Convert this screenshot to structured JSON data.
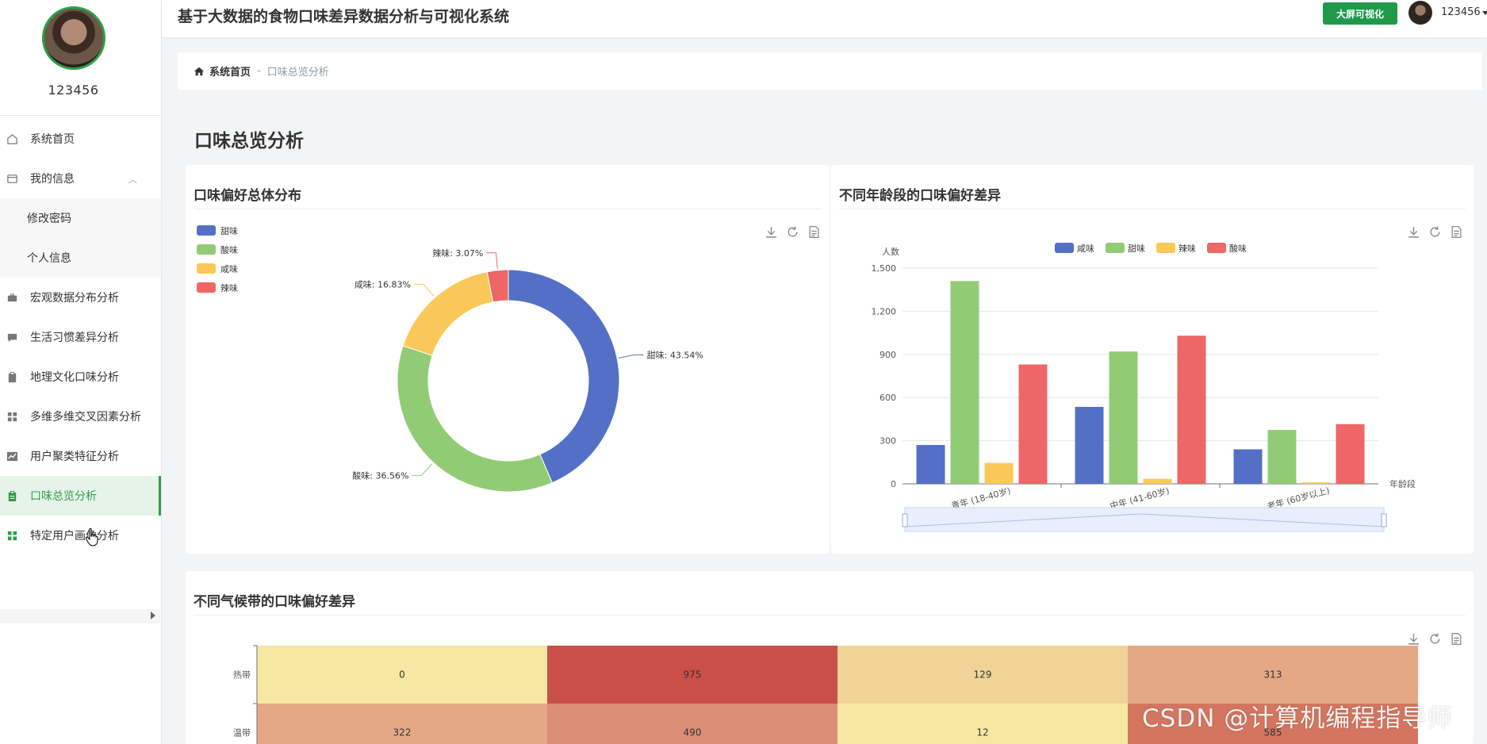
{
  "app": {
    "title": "基于大数据的食物口味差异数据分析与可视化系统",
    "bigscreen_label": "大屏可视化",
    "username": "123456"
  },
  "sidebar": {
    "username": "123456",
    "items": [
      {
        "label": "系统首页",
        "icon": "home-icon"
      },
      {
        "label": "我的信息",
        "icon": "card-icon",
        "expanded": true
      },
      {
        "label": "修改密码",
        "sub": true
      },
      {
        "label": "个人信息",
        "sub": true
      },
      {
        "label": "宏观数据分布分析",
        "icon": "briefcase-icon"
      },
      {
        "label": "生活习惯差异分析",
        "icon": "chat-icon"
      },
      {
        "label": "地理文化口味分析",
        "icon": "clipboard-icon"
      },
      {
        "label": "多维多维交叉因素分析",
        "icon": "grid-icon"
      },
      {
        "label": "用户聚类特征分析",
        "icon": "chart-icon"
      },
      {
        "label": "口味总览分析",
        "icon": "clipboard-icon",
        "active": true
      },
      {
        "label": "特定用户画像分析",
        "icon": "grid-icon"
      }
    ]
  },
  "breadcrumb": {
    "home": "系统首页",
    "separator": "-",
    "current": "口味总览分析"
  },
  "page": {
    "title": "口味总览分析"
  },
  "colors": {
    "accent": "#2e9e48",
    "blue": "#5470c6",
    "green": "#91cc75",
    "yellow": "#fac858",
    "red": "#ee6666"
  },
  "chart_data": [
    {
      "type": "pie",
      "title": "口味偏好总体分布",
      "legend": [
        "甜味",
        "酸味",
        "咸味",
        "辣味"
      ],
      "slices": [
        {
          "name": "甜味",
          "value": 43.54,
          "label": "甜味: 43.54%",
          "color": "#5470c6"
        },
        {
          "name": "酸味",
          "value": 36.56,
          "label": "酸味: 36.56%",
          "color": "#91cc75"
        },
        {
          "name": "咸味",
          "value": 16.83,
          "label": "咸味: 16.83%",
          "color": "#fac858"
        },
        {
          "name": "辣味",
          "value": 3.07,
          "label": "辣味: 3.07%",
          "color": "#ee6666"
        }
      ]
    },
    {
      "type": "bar",
      "title": "不同年龄段的口味偏好差异",
      "ylabel": "人数",
      "xlabel": "年龄段",
      "ylim": [
        0,
        1500
      ],
      "yticks": [
        "0",
        "300",
        "600",
        "900",
        "1,200",
        "1,500"
      ],
      "categories": [
        "青年 (18-40岁)",
        "中年 (41-60岁)",
        "老年 (60岁以上)"
      ],
      "series": [
        {
          "name": "咸味",
          "color": "#5470c6",
          "values": [
            270,
            535,
            240
          ]
        },
        {
          "name": "甜味",
          "color": "#91cc75",
          "values": [
            1410,
            920,
            375
          ]
        },
        {
          "name": "辣味",
          "color": "#fac858",
          "values": [
            145,
            35,
            10
          ]
        },
        {
          "name": "酸味",
          "color": "#ee6666",
          "values": [
            830,
            1030,
            415
          ]
        }
      ]
    },
    {
      "type": "heatmap",
      "title": "不同气候带的口味偏好差异",
      "rows": [
        "热带",
        "温带"
      ],
      "cells": [
        [
          {
            "v": "0",
            "c": "#f6e8a3"
          },
          {
            "v": "975",
            "c": "#c94f49"
          },
          {
            "v": "129",
            "c": "#f0d396"
          },
          {
            "v": "313",
            "c": "#e4a885"
          }
        ],
        [
          {
            "v": "322",
            "c": "#e4a885"
          },
          {
            "v": "490",
            "c": "#db8e74"
          },
          {
            "v": "12",
            "c": "#f6e8a3"
          },
          {
            "v": "585",
            "c": "#d4765f"
          }
        ]
      ]
    }
  ],
  "watermark": "CSDN @计算机编程指导师"
}
